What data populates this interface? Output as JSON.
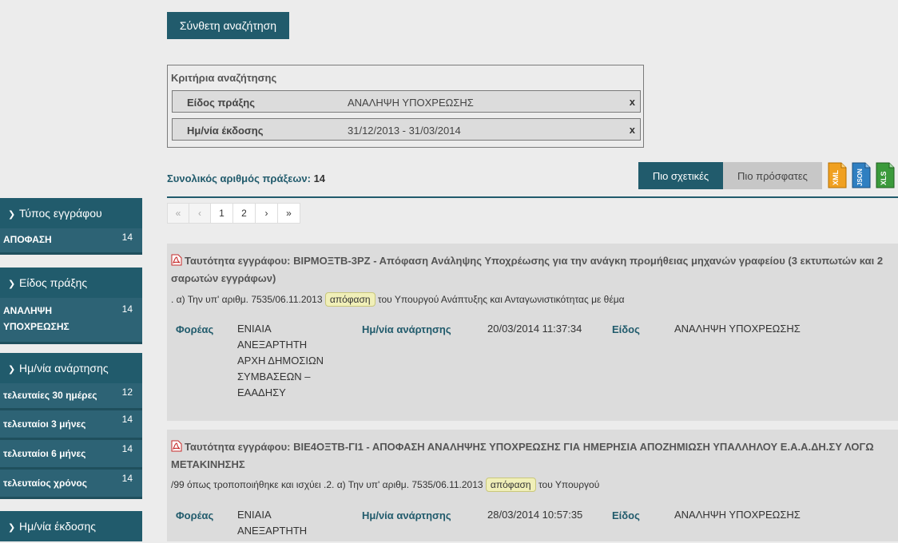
{
  "search": {
    "advanced_button": "Σύνθετη αναζήτηση"
  },
  "criteria": {
    "title": "Κριτήρια αναζήτησης",
    "rows": [
      {
        "label": "Είδος πράξης",
        "value": "ΑΝΑΛΗΨΗ ΥΠΟΧΡΕΩΣΗΣ",
        "remove": "x"
      },
      {
        "label": "Ημ/νία έκδοσης",
        "value": "31/12/2013 - 31/03/2014",
        "remove": "x"
      }
    ]
  },
  "results_summary": {
    "label": "Συνολικός αριθμός πράξεων:",
    "count": "14"
  },
  "sort": {
    "relevant": "Πιο σχετικές",
    "recent": "Πιο πρόσφατες"
  },
  "export": {
    "xml": "XML",
    "json": "JSON",
    "xls": "XLS"
  },
  "pagination": {
    "first": "«",
    "prev": "‹",
    "pages": [
      "1",
      "2"
    ],
    "next": "›",
    "last": "»"
  },
  "sidebar": {
    "facets": [
      {
        "title": "Τύπος εγγράφου",
        "items": [
          {
            "label": "ΑΠΟΦΑΣΗ",
            "count": "14"
          }
        ]
      },
      {
        "title": "Είδος πράξης",
        "items": [
          {
            "label": "ΑΝΑΛΗΨΗ ΥΠΟΧΡΕΩΣΗΣ",
            "count": "14"
          }
        ]
      },
      {
        "title": "Ημ/νία ανάρτησης",
        "items": [
          {
            "label": "τελευταίες 30 ημέρες",
            "count": "12"
          },
          {
            "label": "τελευταίοι 3 μήνες",
            "count": "14"
          },
          {
            "label": "τελευταίοι 6 μήνες",
            "count": "14"
          },
          {
            "label": "τελευταίος χρόνος",
            "count": "14"
          }
        ]
      },
      {
        "title": "Ημ/νία έκδοσης",
        "items": []
      }
    ]
  },
  "results": [
    {
      "title": "Ταυτότητα εγγράφου: ΒΙΡΜΟΞΤΒ-3ΡΖ - Απόφαση Ανάληψης Υποχρέωσης για την ανάγκη προμήθειας μηχανών γραφείου (3 εκτυπωτών και 2 σαρωτών εγγράφων)",
      "snippet_before": ". α) Την υπ' αριθμ. 7535/06.11.2013",
      "snippet_tag": "απόφαση",
      "snippet_after": "του Υπουργού Ανάπτυξης και Ανταγωνιστικότητας με θέμα",
      "foreas_label": "Φορέας",
      "foreas_lines": [
        "ΕΝΙΑΙΑ",
        "ΑΝΕΞΑΡΤΗΤΗ",
        "ΑΡΧΗ ΔΗΜΟΣΙΩΝ",
        "ΣΥΜΒΑΣΕΩΝ –",
        "ΕΑΑΔΗΣΥ"
      ],
      "date_label": "Ημ/νία ανάρτησης",
      "date_value": "20/03/2014 11:37:34",
      "type_label": "Είδος",
      "type_value": "ΑΝΑΛΗΨΗ ΥΠΟΧΡΕΩΣΗΣ"
    },
    {
      "title": "Ταυτότητα εγγράφου: ΒΙΕ4ΟΞΤΒ-ΓΙ1 - ΑΠΟΦΑΣΗ ΑΝΑΛΗΨΗΣ ΥΠΟΧΡΕΩΣΗΣ ΓΙΑ ΗΜΕΡΗΣΙΑ ΑΠΟΖΗΜΙΩΣΗ ΥΠΑΛΛΗΛΟΥ Ε.Α.Α.ΔΗ.ΣΥ ΛΟΓΩ ΜΕΤΑΚΙΝΗΣΗΣ",
      "snippet_before": "/99 όπως τροποποιήθηκε και ισχύει .2. α) Την υπ' αριθμ. 7535/06.11.2013",
      "snippet_tag": "απόφαση",
      "snippet_after": "του Υπουργού",
      "foreas_label": "Φορέας",
      "foreas_lines": [
        "ΕΝΙΑΙΑ",
        "ΑΝΕΞΑΡΤΗΤΗ"
      ],
      "date_label": "Ημ/νία ανάρτησης",
      "date_value": "28/03/2014 10:57:35",
      "type_label": "Είδος",
      "type_value": "ΑΝΑΛΗΨΗ ΥΠΟΧΡΕΩΣΗΣ"
    }
  ]
}
